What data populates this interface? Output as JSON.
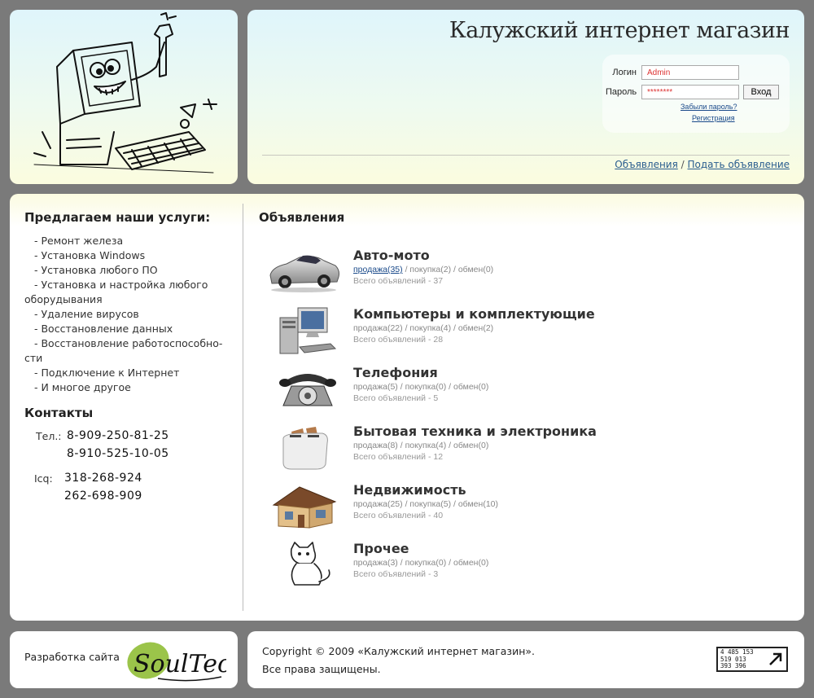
{
  "header": {
    "site_title": "Калужский интернет магазин",
    "login": {
      "login_label": "Логин",
      "login_value": "Admin",
      "password_label": "Пароль",
      "password_value": "********",
      "submit_label": "Вход",
      "forgot_label": "Забыли пароль?",
      "register_label": "Регистрация"
    },
    "nav": {
      "ads_label": "Объявления",
      "separator": "/",
      "post_label": "Подать объявление"
    }
  },
  "sidebar": {
    "services_title": "Предлагаем наши услуги:",
    "services": [
      "- Ремонт железа",
      "- Установка Windows",
      "- Установка любого ПО",
      "- Установка и настройка любого оборудывания",
      "- Удаление вирусов",
      "- Восстановление данных",
      "- Восстановление работоспособно-сти",
      "- Подключение к Интернет",
      "- И многое другое"
    ],
    "contacts_title": "Контакты",
    "phone_label": "Тел.:",
    "phones": [
      "8-909-250-81-25",
      "8-910-525-10-05"
    ],
    "icq_label": "Icq:",
    "icqs": [
      "318-268-924",
      "262-698-909"
    ]
  },
  "main": {
    "title": "Объявления",
    "categories": [
      {
        "title": "Авто-мото",
        "sale": "продажа(35)",
        "buy": "покупка(2)",
        "exchange": "обмен(0)",
        "total": "Всего объявлений - 37",
        "icon": "car-icon"
      },
      {
        "title": "Компьютеры и комплектующие",
        "sale": "продажа(22)",
        "buy": "покупка(4)",
        "exchange": "обмен(2)",
        "total": "Всего объявлений - 28",
        "icon": "computer-icon"
      },
      {
        "title": "Телефония",
        "sale": "продажа(5)",
        "buy": "покупка(0)",
        "exchange": "обмен(0)",
        "total": "Всего объявлений - 5",
        "icon": "telephone-icon"
      },
      {
        "title": "Бытовая техника и электроника",
        "sale": "продажа(8)",
        "buy": "покупка(4)",
        "exchange": "обмен(0)",
        "total": "Всего объявлений - 12",
        "icon": "toaster-icon"
      },
      {
        "title": "Недвижимость",
        "sale": "продажа(25)",
        "buy": "покупка(5)",
        "exchange": "обмен(10)",
        "total": "Всего объявлений - 40",
        "icon": "house-icon"
      },
      {
        "title": "Прочее",
        "sale": "продажа(3)",
        "buy": "покупка(0)",
        "exchange": "обмен(0)",
        "total": "Всего объявлений - 3",
        "icon": "cat-icon"
      }
    ],
    "link_separator": "/"
  },
  "footer": {
    "developer_label": "Разработка сайта",
    "developer_logo_text": "SoulTech",
    "copyright_line1": "Copyright © 2009 «Калужский интернет магазин».",
    "copyright_line2": "Все права защищены.",
    "counter_lines": [
      "4 485 153",
      "519 013",
      "393 396"
    ]
  }
}
